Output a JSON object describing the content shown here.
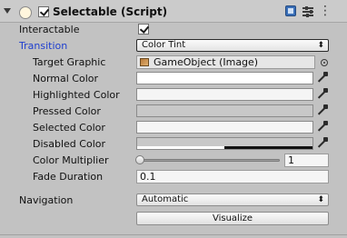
{
  "component": {
    "title": "Selectable (Script)",
    "enabled": true,
    "icons": [
      "help-icon",
      "preset-icon",
      "gear-icon"
    ]
  },
  "fields": {
    "interactable": {
      "label": "Interactable",
      "checked": true
    },
    "transition": {
      "label": "Transition",
      "value": "Color Tint",
      "highlight_color": "#1f3fcf"
    },
    "target_graphic": {
      "label": "Target Graphic",
      "value": "GameObject (Image)"
    },
    "normal_color": {
      "label": "Normal Color",
      "color": "#ffffff"
    },
    "highlighted_color": {
      "label": "Highlighted Color",
      "color": "#f5f5f5"
    },
    "pressed_color": {
      "label": "Pressed Color",
      "color": "#c8c8c8"
    },
    "selected_color": {
      "label": "Selected Color",
      "color": "#f5f5f5"
    },
    "disabled_color": {
      "label": "Disabled Color",
      "color": "#c8c8c8",
      "alpha": 0.5
    },
    "color_multiplier": {
      "label": "Color Multiplier",
      "value": "1",
      "slider_fraction": 0.0
    },
    "fade_duration": {
      "label": "Fade Duration",
      "value": "0.1"
    },
    "navigation": {
      "label": "Navigation",
      "value": "Automatic"
    },
    "visualize": {
      "label": "Visualize"
    }
  },
  "dropdown_arrow": "⬍"
}
